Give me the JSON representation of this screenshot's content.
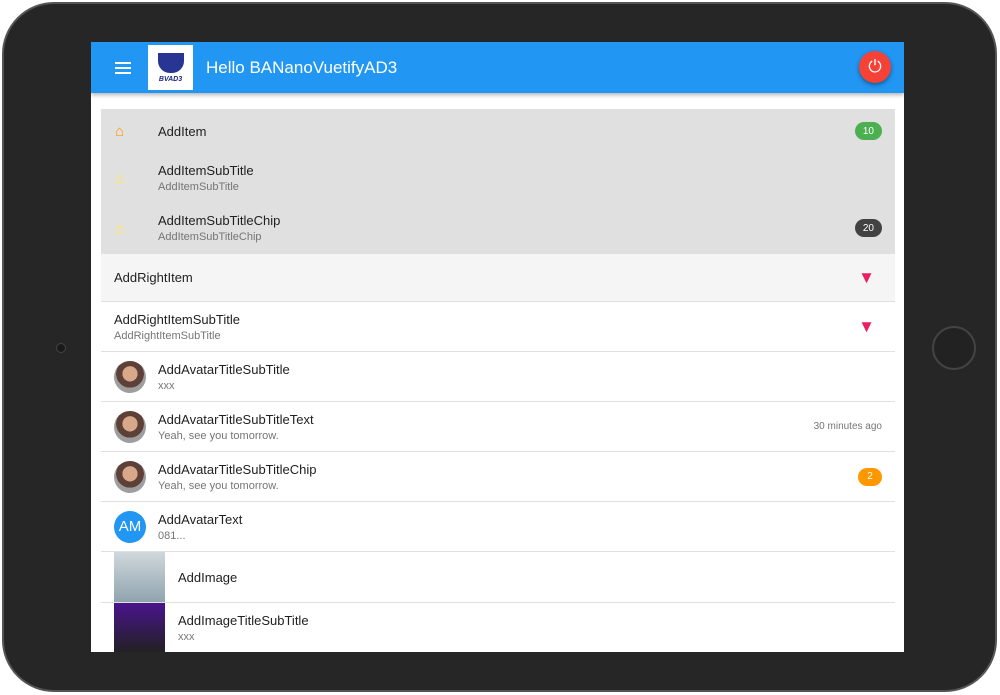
{
  "header": {
    "title": "Hello BANanoVuetifyAD3",
    "logo_text": "BVAD3"
  },
  "colors": {
    "primary": "#2196F3",
    "green": "#4CAF50",
    "dark": "#424242",
    "orange": "#FF9800",
    "red": "#f44336",
    "pink": "#e91e63"
  },
  "items": [
    {
      "title": "AddItem",
      "chip": "10"
    },
    {
      "title": "AddItemSubTitle",
      "subtitle": "AddItemSubTitle"
    },
    {
      "title": "AddItemSubTitleChip",
      "subtitle": "AddItemSubTitleChip",
      "chip": "20"
    },
    {
      "title": "AddRightItem"
    },
    {
      "title": "AddRightItemSubTitle",
      "subtitle": "AddRightItemSubTitle"
    },
    {
      "title": "AddAvatarTitleSubTitle",
      "subtitle": "xxx"
    },
    {
      "title": "AddAvatarTitleSubTitleText",
      "subtitle": "Yeah, see you tomorrow.",
      "action_text": "30 minutes ago"
    },
    {
      "title": "AddAvatarTitleSubTitleChip",
      "subtitle": "Yeah, see you tomorrow.",
      "chip": "2"
    },
    {
      "title": "AddAvatarText",
      "subtitle": "081...",
      "avatar_text": "AM"
    },
    {
      "title": "AddImage"
    },
    {
      "title": "AddImageTitleSubTitle",
      "subtitle": "xxx"
    }
  ]
}
